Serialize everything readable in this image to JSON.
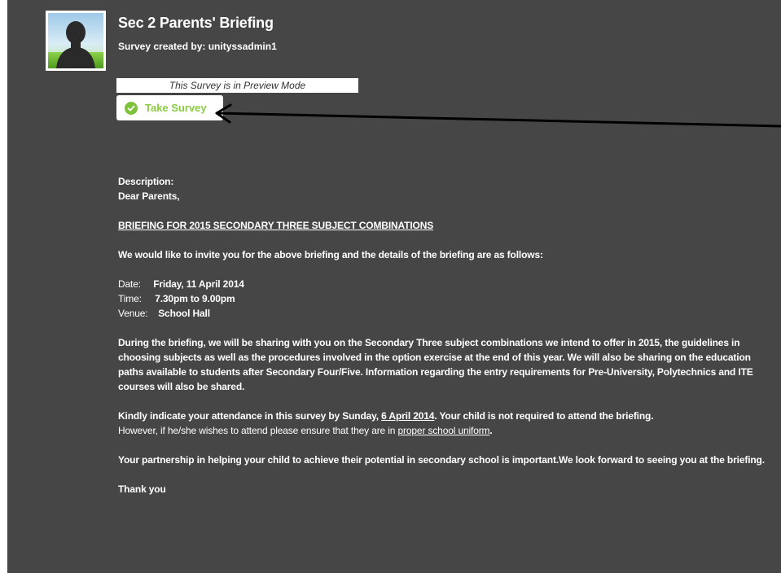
{
  "survey": {
    "title": "Sec 2 Parents' Briefing",
    "creator": "Survey created by: unityssadmin1",
    "preview_notice": "This Survey is in Preview Mode",
    "take_button": "Take Survey",
    "check_icon": "check-circle-icon",
    "avatar_icon": "user-silhouette-icon"
  },
  "description": {
    "label": "Description:",
    "greeting": "Dear Parents,",
    "heading": "BRIEFING FOR 2015 SECONDARY THREE SUBJECT COMBINATIONS",
    "intro": "We would like to invite you for the above briefing and the details of the briefing are as follows:",
    "details": {
      "date_label": "Date:",
      "date_value": "Friday, 11 April 2014",
      "time_label": "Time:",
      "time_value": "7.30pm to 9.00pm",
      "venue_label": "Venue:",
      "venue_value": "School Hall"
    },
    "para1": "During the briefing, we will be sharing with you on the Secondary Three subject combinations we intend to offer in 2015, the guidelines in choosing subjects as well as the procedures involved in the option exercise at the end of this year. We will also be sharing on the education paths available to students after Secondary Four/Five. Information regarding the entry requirements for Pre-University, Polytechnics and ITE courses will also be shared.",
    "para2_a": "Kindly indicate your attendance in this survey by Sunday, ",
    "para2_date": "6 April 2014",
    "para2_b": ". Your child is not required to attend the briefing.",
    "para2_c": "However, if he/she wishes to attend please ensure that they are in ",
    "para2_uniform": "proper school uniform",
    "para2_d": ".",
    "para3": "Your partnership in helping your child to achieve their potential in secondary school is important.We look forward to seeing you at the briefing.",
    "closing": "Thank you"
  },
  "colors": {
    "panel_bg": "#464646",
    "accent_green": "#8ccc44",
    "text": "#ffffff"
  }
}
